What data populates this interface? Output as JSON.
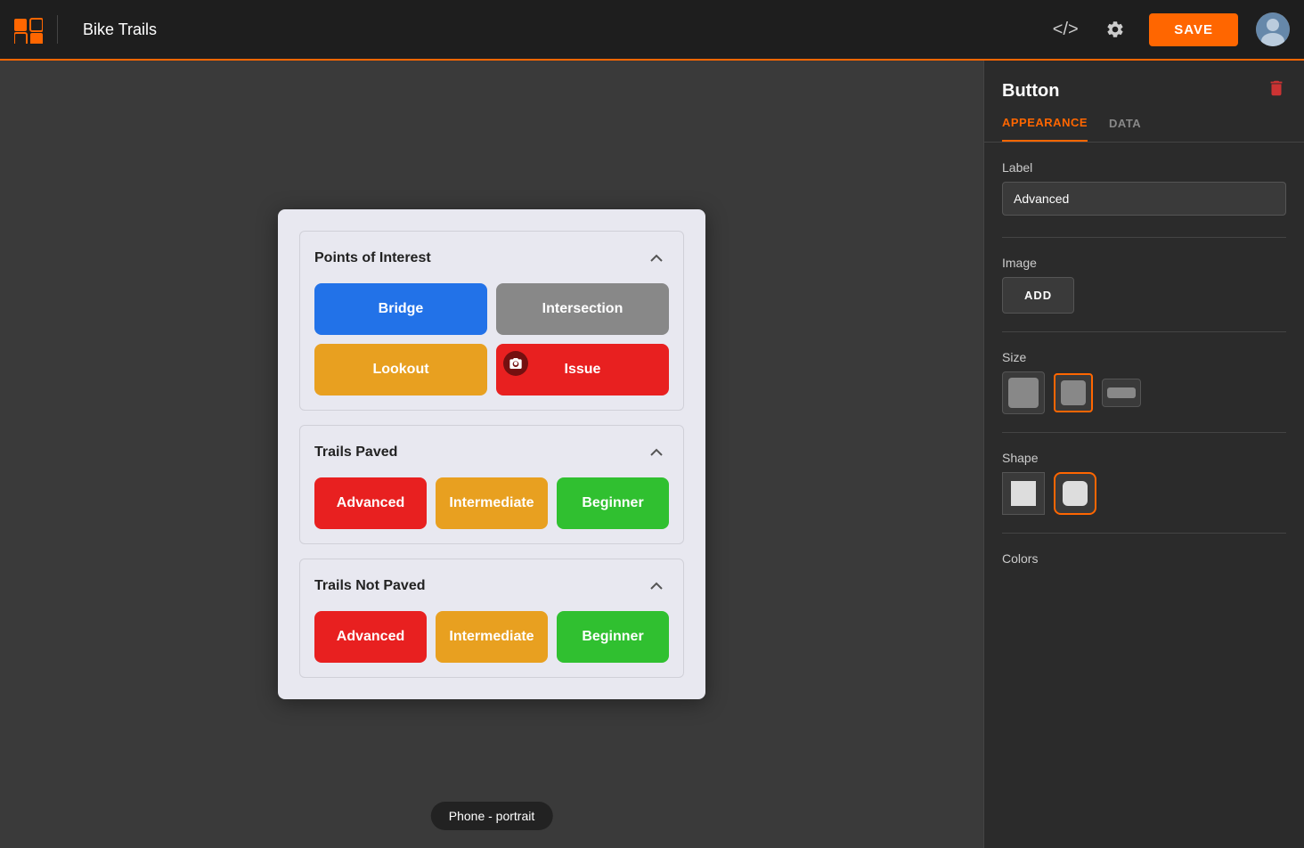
{
  "topbar": {
    "title": "Bike Trails",
    "save_label": "SAVE",
    "code_icon": "</>",
    "settings_icon": "⚙"
  },
  "canvas": {
    "footer_label": "Phone - portrait",
    "sections": [
      {
        "id": "points-of-interest",
        "title": "Points of Interest",
        "buttons": [
          {
            "label": "Bridge",
            "color": "blue"
          },
          {
            "label": "Intersection",
            "color": "gray"
          },
          {
            "label": "Lookout",
            "color": "yellow"
          },
          {
            "label": "Issue",
            "color": "red"
          }
        ],
        "grid": "2"
      },
      {
        "id": "trails-paved",
        "title": "Trails Paved",
        "buttons": [
          {
            "label": "Advanced",
            "color": "red"
          },
          {
            "label": "Intermediate",
            "color": "yellow"
          },
          {
            "label": "Beginner",
            "color": "green"
          }
        ],
        "grid": "3"
      },
      {
        "id": "trails-not-paved",
        "title": "Trails Not Paved",
        "buttons": [
          {
            "label": "Advanced",
            "color": "red"
          },
          {
            "label": "Intermediate",
            "color": "yellow"
          },
          {
            "label": "Beginner",
            "color": "green"
          }
        ],
        "grid": "3"
      }
    ]
  },
  "panel": {
    "title": "Button",
    "tabs": [
      {
        "id": "appearance",
        "label": "APPEARANCE",
        "active": true
      },
      {
        "id": "data",
        "label": "DATA",
        "active": false
      }
    ],
    "label_field": {
      "label": "Label",
      "value": "Advanced"
    },
    "image_section": {
      "label": "Image",
      "add_button_label": "ADD"
    },
    "size_section": {
      "label": "Size",
      "options": [
        {
          "id": "large",
          "active": false
        },
        {
          "id": "medium",
          "active": true
        },
        {
          "id": "small",
          "active": false
        }
      ]
    },
    "shape_section": {
      "label": "Shape",
      "options": [
        {
          "id": "square",
          "active": false
        },
        {
          "id": "rounded",
          "active": true
        }
      ]
    },
    "colors_section": {
      "label": "Colors"
    }
  }
}
